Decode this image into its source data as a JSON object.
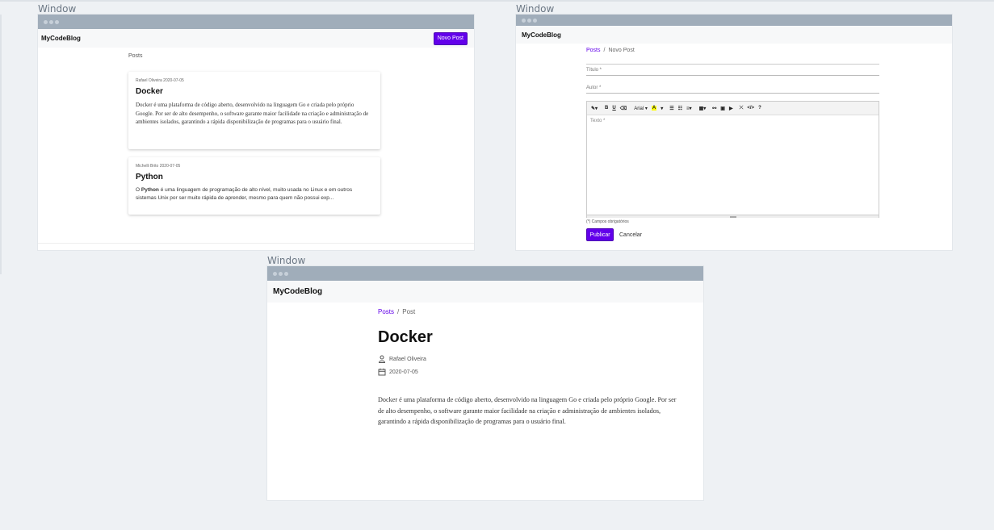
{
  "window_label": "Window",
  "list_window": {
    "brand": "MyCodeBlog",
    "new_post_button": "Novo Post",
    "section_title": "Posts",
    "posts": [
      {
        "meta": "Rafael Oliveira 2020-07-05",
        "title": "Docker",
        "excerpt": "Docker é uma plataforma de código aberto, desenvolvido na linguagem Go e criada pelo próprio Google. Por ser de alto desempenho, o software garante maior facilidade na criação e administração de ambientes isolados, garantindo a rápida disponibilização de programas para o usuário final."
      },
      {
        "meta": "Michelli Brito 2020-07-05",
        "title": "Python",
        "excerpt_lead": "O ",
        "excerpt_bold": "Python",
        "excerpt_rest": " é uma linguagem de programação de alto nível, muito usada no Linux e em outros sistemas Unix por ser muito rápida de aprender, mesmo para quem não possui exp..."
      }
    ]
  },
  "form_window": {
    "brand": "MyCodeBlog",
    "breadcrumb": {
      "link": "Posts",
      "separator": "/",
      "current": "Novo Post"
    },
    "title_placeholder": "Título *",
    "author_placeholder": "Autor *",
    "text_placeholder": "Texto *",
    "toolbar": {
      "magic": "✎▾",
      "bold": "B",
      "underline": "U",
      "clear": "⌫",
      "font": "Arial ▾",
      "color": "A",
      "color_caret": "▾",
      "ul": "☰",
      "ol": "☷",
      "align": "≡▾",
      "table": "▦▾",
      "link": "⚯",
      "image": "▣",
      "video": "▶",
      "fullscreen": "⤫",
      "code": "</>",
      "help": "?"
    },
    "required_note": "(*) Campos obrigatórios",
    "publish_button": "Publicar",
    "cancel_button": "Cancelar"
  },
  "detail_window": {
    "brand": "MyCodeBlog",
    "breadcrumb": {
      "link": "Posts",
      "separator": "/",
      "current": "Post"
    },
    "title": "Docker",
    "author": "Rafael Oliveira",
    "date": "2020-07-05",
    "body": "Docker é uma plataforma de código aberto, desenvolvido na linguagem Go e criada pelo próprio Google. Por ser de alto desempenho, o software garante maior facilidade na criação e administração de ambientes isolados, garantindo a rápida disponibilização de programas para o usuário final."
  }
}
